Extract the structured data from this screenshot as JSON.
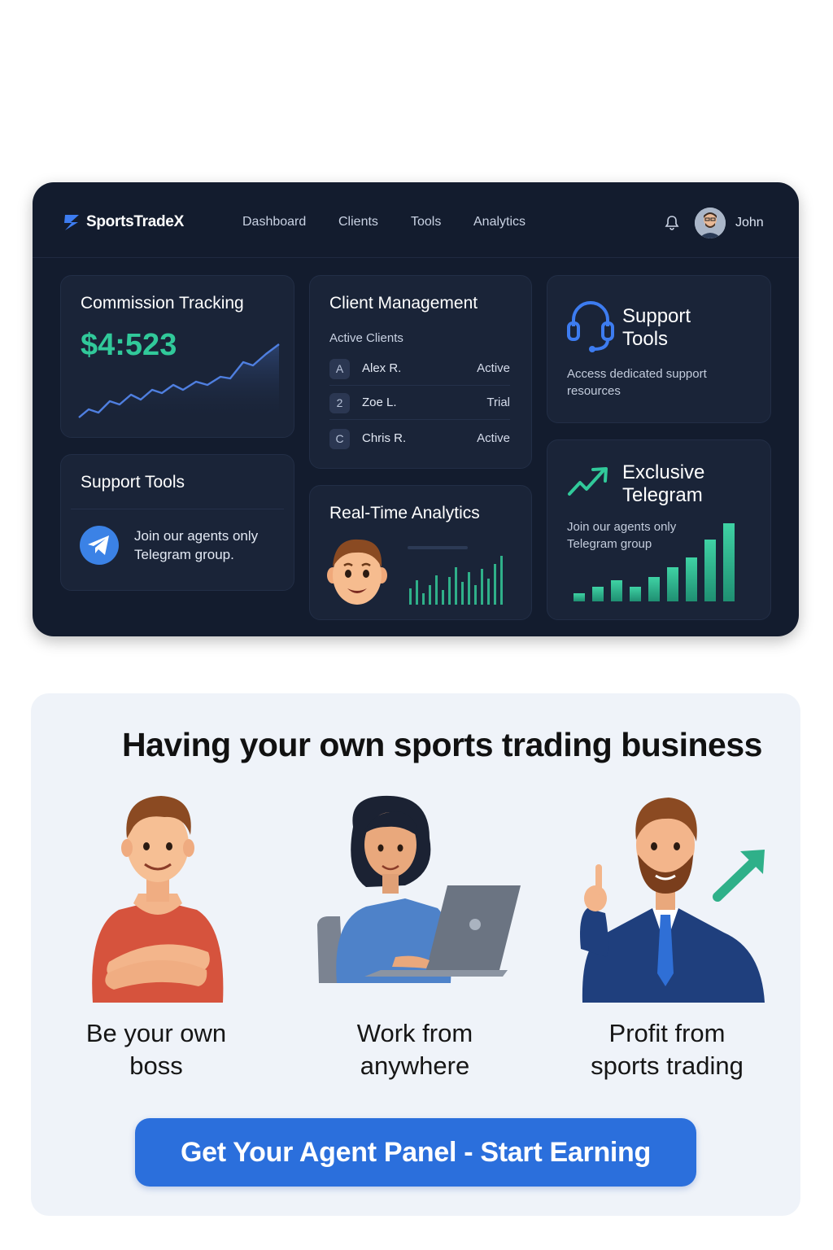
{
  "app": {
    "brand": "SportsTradeX",
    "nav": [
      "Dashboard",
      "Clients",
      "Tools",
      "Analytics"
    ],
    "user": "John"
  },
  "commission": {
    "title": "Commission Tracking",
    "amount": "$4:523"
  },
  "clients": {
    "title": "Client Management",
    "subtitle": "Active Clients",
    "rows": [
      {
        "badge": "A",
        "name": "Alex R.",
        "status": "Active"
      },
      {
        "badge": "2",
        "name": "Zoe L.",
        "status": "Trial"
      },
      {
        "badge": "C",
        "name": "Chris R.",
        "status": "Active"
      }
    ]
  },
  "support_card": {
    "title": "Support Tools",
    "desc": "Access dedicated support resources"
  },
  "support_left": {
    "title": "Support Tools",
    "desc": "Join our agents only Telegram group."
  },
  "analytics": {
    "title": "Real-Time Analytics"
  },
  "telegram": {
    "title": "Exclusive Telegram",
    "desc": "Join our agents only Telegram group"
  },
  "promo": {
    "headline": "Having your own sports trading business",
    "features": [
      {
        "line1": "Be your own",
        "line2": "boss"
      },
      {
        "line1": "Work from",
        "line2": "anywhere"
      },
      {
        "line1": "Profit from",
        "line2": "sports trading"
      }
    ],
    "cta": "Get Your Agent Panel - Start Earning"
  },
  "colors": {
    "panel_bg": "#131c2e",
    "card_bg": "#1a2438",
    "accent_green": "#31c99a",
    "cta_blue": "#2b6fdc"
  }
}
